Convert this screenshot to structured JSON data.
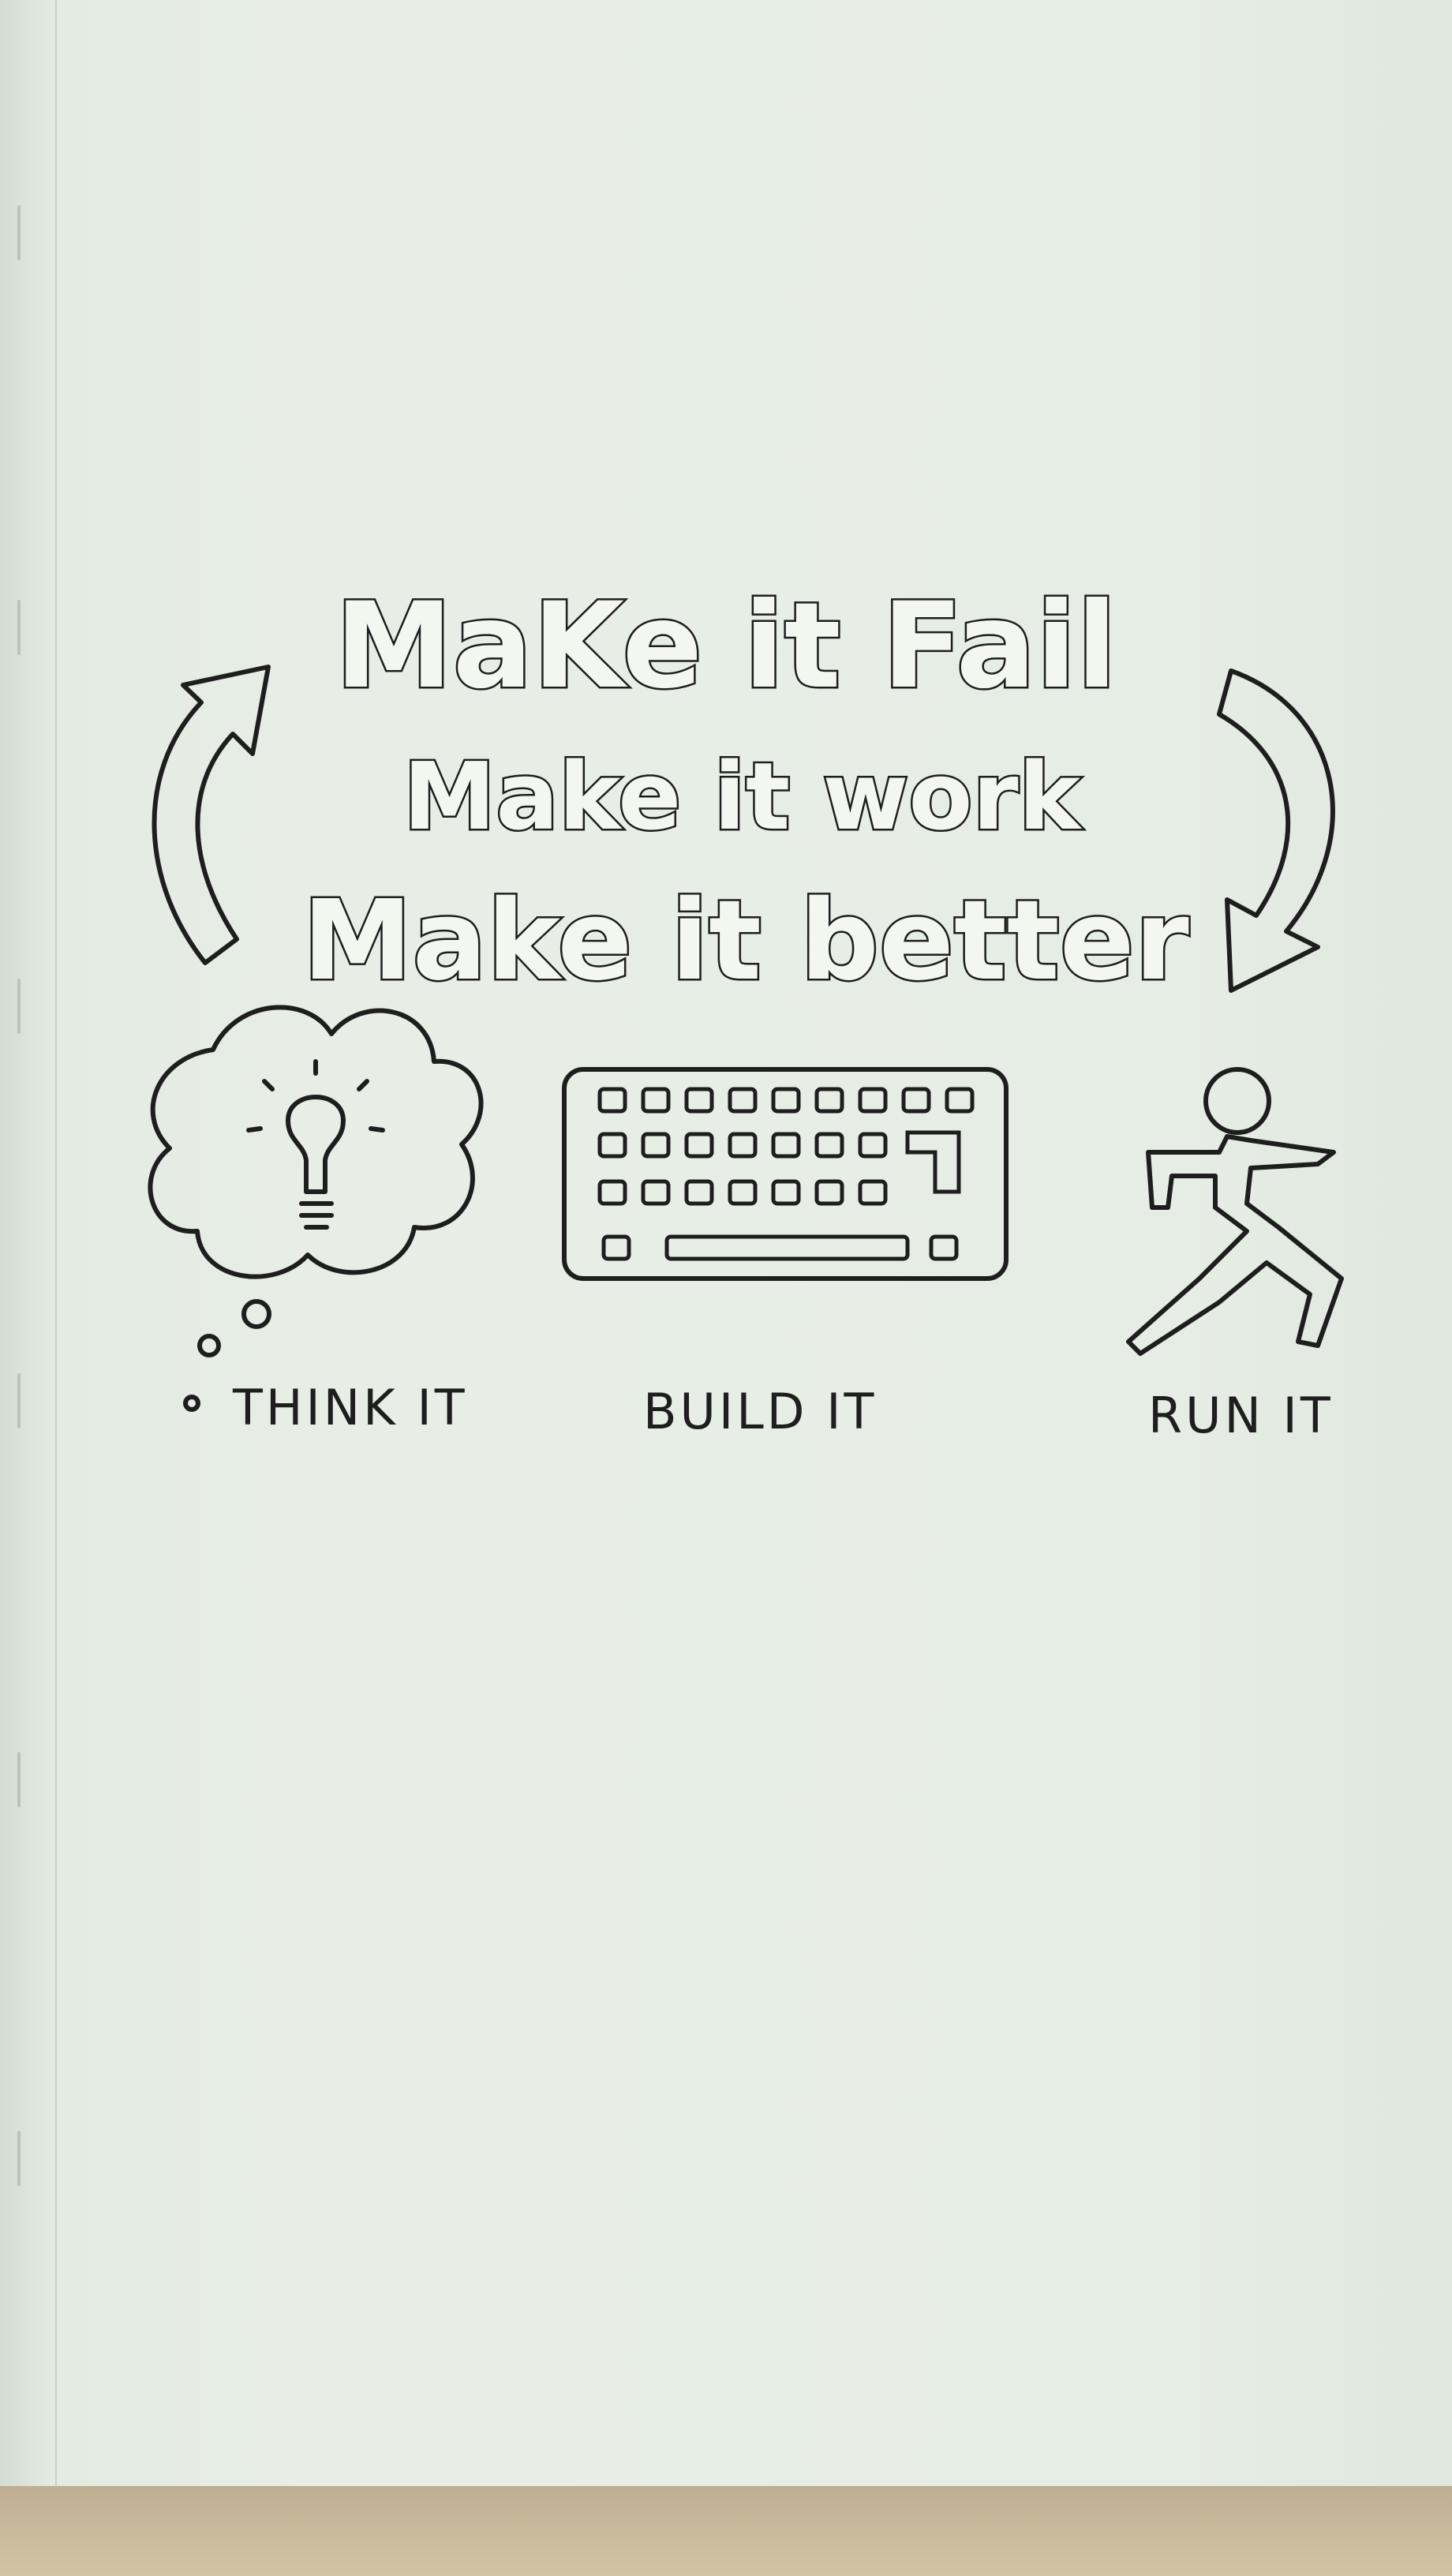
{
  "headline": {
    "line1": "MaKe it Fail",
    "line2": "Make it work",
    "line3": "Make it better"
  },
  "labels": {
    "think": "THINK IT",
    "build": "BUILD IT",
    "run": "RUN IT"
  },
  "icons": {
    "cycle_left": "curved-arrow-up-icon",
    "cycle_right": "curved-arrow-down-icon",
    "think": "thought-bubble-lightbulb-icon",
    "build": "keyboard-icon",
    "run": "running-figure-icon"
  }
}
